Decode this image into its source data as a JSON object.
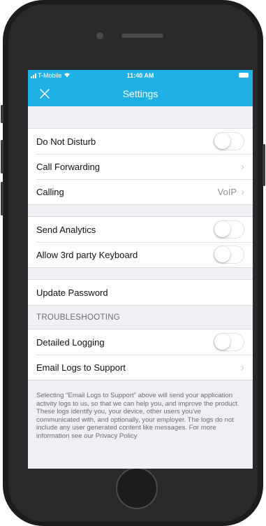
{
  "status_bar": {
    "carrier": "T-Mobile",
    "time": "11:40 AM"
  },
  "header": {
    "title": "Settings",
    "close_icon": "close-icon"
  },
  "groups": [
    {
      "rows": [
        {
          "label": "Do Not Disturb",
          "control": "toggle",
          "on": false
        },
        {
          "label": "Call Forwarding",
          "control": "chevron"
        },
        {
          "label": "Calling",
          "value": "VoIP",
          "control": "chevron"
        }
      ]
    },
    {
      "rows": [
        {
          "label": "Send Analytics",
          "control": "toggle",
          "on": false
        },
        {
          "label": "Allow 3rd party Keyboard",
          "control": "toggle",
          "on": false
        }
      ]
    },
    {
      "rows": [
        {
          "label": "Update Password",
          "control": "none"
        }
      ]
    }
  ],
  "troubleshooting": {
    "header": "TROUBLESHOOTING",
    "rows": [
      {
        "label": "Detailed Logging",
        "control": "toggle",
        "on": false
      },
      {
        "label": "Email Logs to Support",
        "control": "chevron"
      }
    ],
    "footer": "Selecting “Email Logs to Support” above will send your application activity logs to us, so that we can help you, and improve the product. These logs identify you, your device, other users you've communicated with, and optionally, your employer. The logs do not include any user generated content like messages. For more information see our Privacy Policy"
  },
  "colors": {
    "accent": "#1fb1e5",
    "background": "#efeff4",
    "row_background": "#ffffff"
  }
}
